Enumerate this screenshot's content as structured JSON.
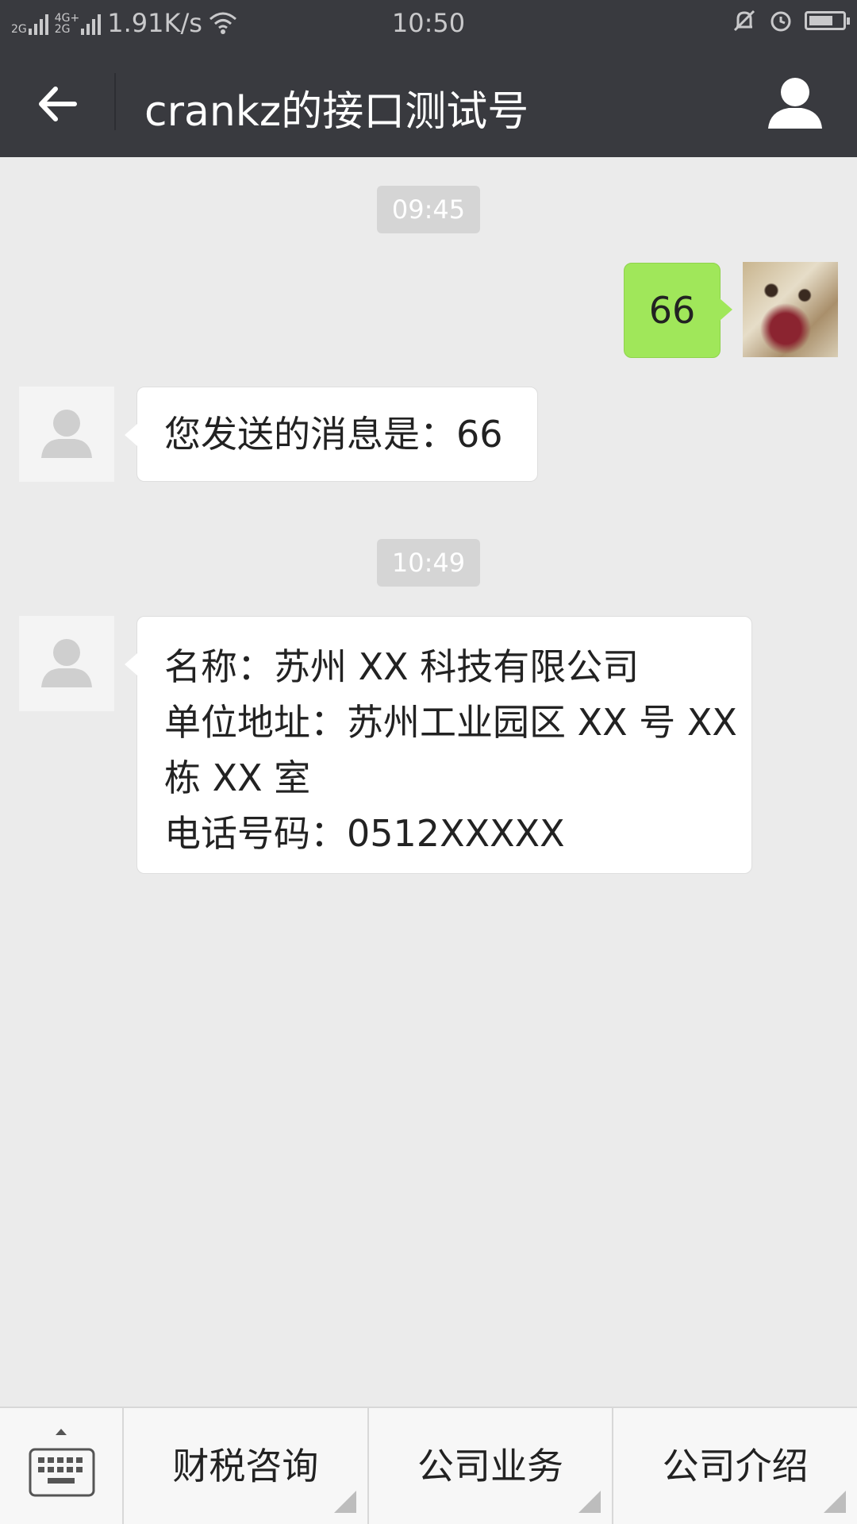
{
  "status_bar": {
    "net1": "2G",
    "net2a": "4G+",
    "net2b": "2G",
    "speed": "1.91K/s",
    "time": "10:50"
  },
  "header": {
    "title": "crankz的接口测试号"
  },
  "messages": [
    {
      "type": "time",
      "text": "09:45"
    },
    {
      "type": "sent",
      "text": "66"
    },
    {
      "type": "received",
      "lines": [
        "您发送的消息是：66"
      ]
    },
    {
      "type": "time",
      "text": "10:49"
    },
    {
      "type": "received",
      "lines": [
        "名称：苏州 XX 科技有限公司",
        "单位地址：苏州工业园区 XX 号 XX",
        "栋 XX 室",
        "电话号码：0512XXXXX"
      ]
    }
  ],
  "bottom_menu": {
    "items": [
      "财税咨询",
      "公司业务",
      "公司介绍"
    ]
  },
  "colors": {
    "header_bg": "#393a3f",
    "chat_bg": "#ebebeb",
    "sent_bubble": "#a0e75a"
  }
}
